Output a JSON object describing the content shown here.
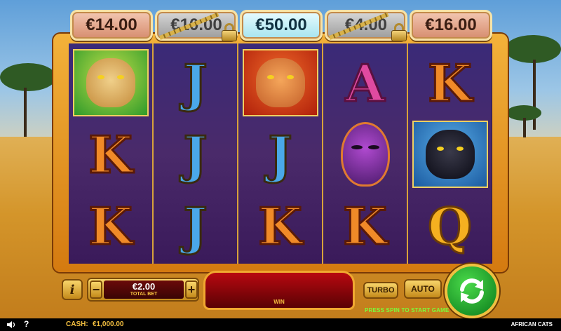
{
  "jackpots": [
    {
      "value": "€14.00",
      "state": "active",
      "style": "copper"
    },
    {
      "value": "€10.00",
      "state": "locked",
      "style": "silver"
    },
    {
      "value": "€50.00",
      "state": "active",
      "style": "cyan"
    },
    {
      "value": "€4.00",
      "state": "locked",
      "style": "silver"
    },
    {
      "value": "€16.00",
      "state": "active",
      "style": "copper"
    }
  ],
  "reels": [
    [
      "cheetah",
      "K",
      "K"
    ],
    [
      "J",
      "J",
      "J"
    ],
    [
      "lion",
      "J",
      "K"
    ],
    [
      "A",
      "mask",
      "K"
    ],
    [
      "K",
      "panther",
      "Q"
    ]
  ],
  "controls": {
    "info_label": "i",
    "minus_label": "−",
    "plus_label": "+",
    "bet_value": "€2.00",
    "bet_label": "TOTAL BET",
    "win_label": "WIN",
    "turbo_label": "TURBO",
    "auto_label": "AUTO",
    "press_text": "PRESS SPIN TO START GAME"
  },
  "status": {
    "help_label": "?",
    "cash_label": "CASH:",
    "cash_value": "€1,000.00",
    "game_title": "AFRICAN CATS"
  },
  "colors": {
    "frame_gold": "#f3b23a",
    "reel_purple": "#3a2a78",
    "win_red": "#b80810",
    "spin_green": "#0a7a1a",
    "accent_text": "#f5c040",
    "press_text": "#7aff3a"
  }
}
